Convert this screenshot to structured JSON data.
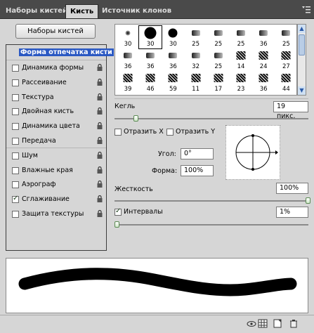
{
  "tabs": [
    {
      "label": "Наборы кистей"
    },
    {
      "label": "Кисть"
    },
    {
      "label": "Источник клонов"
    }
  ],
  "presets_button": "Наборы кистей",
  "sidebar": {
    "header": "Форма отпечатка кисти",
    "items": [
      {
        "label": "Динамика формы",
        "checked": false
      },
      {
        "label": "Рассеивание",
        "checked": false
      },
      {
        "label": "Текстура",
        "checked": false
      },
      {
        "label": "Двойная кисть",
        "checked": false
      },
      {
        "label": "Динамика цвета",
        "checked": false
      },
      {
        "label": "Передача",
        "checked": false
      },
      {
        "label": "Шум",
        "checked": false
      },
      {
        "label": "Влажные края",
        "checked": false
      },
      {
        "label": "Аэрограф",
        "checked": false
      },
      {
        "label": "Сглаживание",
        "checked": true
      },
      {
        "label": "Защита текстуры",
        "checked": false
      }
    ]
  },
  "brush_grid": {
    "sizes": [
      "30",
      "30",
      "30",
      "25",
      "25",
      "25",
      "36",
      "25",
      "36",
      "36",
      "36",
      "32",
      "25",
      "14",
      "24",
      "27",
      "39",
      "46",
      "59",
      "11",
      "17",
      "23",
      "36",
      "44"
    ],
    "selected_index": 1
  },
  "size": {
    "label": "Кегль",
    "value": "19 пикс.",
    "fraction": 0.1
  },
  "flip_x": {
    "label": "Отразить X",
    "checked": false
  },
  "flip_y": {
    "label": "Отразить Y",
    "checked": false
  },
  "angle": {
    "label": "Угол:",
    "value": "0°"
  },
  "roundness": {
    "label": "Форма:",
    "value": "100%"
  },
  "hardness": {
    "label": "Жесткость",
    "value": "100%",
    "fraction": 1.0
  },
  "spacing": {
    "label": "Интервалы",
    "value": "1%",
    "checked": true,
    "fraction": 0.0
  }
}
